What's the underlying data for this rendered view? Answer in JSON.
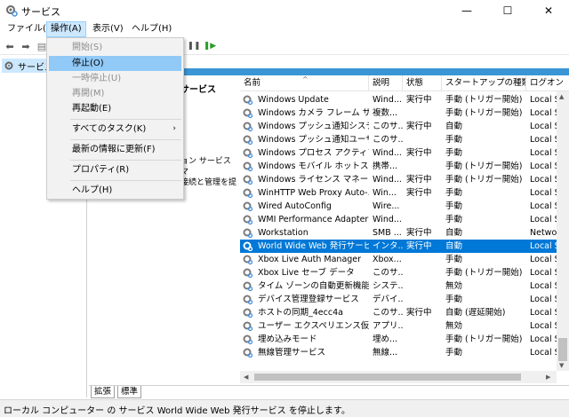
{
  "window": {
    "title": "サービス"
  },
  "menu": [
    {
      "label": "ファイル(F)"
    },
    {
      "label": "操作(A)"
    },
    {
      "label": "表示(V)"
    },
    {
      "label": "ヘルプ(H)"
    }
  ],
  "tree": {
    "label": "サービス"
  },
  "description": {
    "title": "サービス",
    "body": "ョン サービス マ\n接続と管理を提"
  },
  "columns": [
    "名前",
    "説明",
    "状態",
    "スタートアップの種類",
    "ログオン"
  ],
  "rows": [
    {
      "name": "Windows Update",
      "desc": "Wind...",
      "status": "実行中",
      "startup": "手動 (トリガー開始)",
      "logon": "Local S"
    },
    {
      "name": "Windows カメラ フレーム サーバー",
      "desc": "複数...",
      "status": "",
      "startup": "手動 (トリガー開始)",
      "logon": "Local S"
    },
    {
      "name": "Windows プッシュ通知システム...",
      "desc": "このサ...",
      "status": "実行中",
      "startup": "自動",
      "logon": "Local S"
    },
    {
      "name": "Windows プッシュ通知ユーザー...",
      "desc": "このサ...",
      "status": "",
      "startup": "手動",
      "logon": "Local S"
    },
    {
      "name": "Windows プロセス アクティブ化...",
      "desc": "Wind...",
      "status": "実行中",
      "startup": "手動",
      "logon": "Local S"
    },
    {
      "name": "Windows モバイル ホットスポッ...",
      "desc": "携帯...",
      "status": "",
      "startup": "手動 (トリガー開始)",
      "logon": "Local S"
    },
    {
      "name": "Windows ライセンス マネージャ...",
      "desc": "Wind...",
      "status": "実行中",
      "startup": "手動 (トリガー開始)",
      "logon": "Local S"
    },
    {
      "name": "WinHTTP Web Proxy Auto-...",
      "desc": "Win...",
      "status": "実行中",
      "startup": "手動",
      "logon": "Local S"
    },
    {
      "name": "Wired AutoConfig",
      "desc": "Wire...",
      "status": "",
      "startup": "手動",
      "logon": "Local S"
    },
    {
      "name": "WMI Performance Adapter",
      "desc": "Wind...",
      "status": "",
      "startup": "手動",
      "logon": "Local S"
    },
    {
      "name": "Workstation",
      "desc": "SMB ...",
      "status": "実行中",
      "startup": "自動",
      "logon": "Networ"
    },
    {
      "name": "World Wide Web 発行サービス",
      "desc": "インタ...",
      "status": "実行中",
      "startup": "自動",
      "logon": "Local S",
      "selected": true
    },
    {
      "name": "Xbox Live Auth Manager",
      "desc": "Xbox...",
      "status": "",
      "startup": "手動",
      "logon": "Local S"
    },
    {
      "name": "Xbox Live セーブ データ",
      "desc": "このサ...",
      "status": "",
      "startup": "手動 (トリガー開始)",
      "logon": "Local S"
    },
    {
      "name": "タイム ゾーンの自動更新機能",
      "desc": "システ...",
      "status": "",
      "startup": "無効",
      "logon": "Local S"
    },
    {
      "name": "デバイス管理登録サービス",
      "desc": "デバイ...",
      "status": "",
      "startup": "手動",
      "logon": "Local S"
    },
    {
      "name": "ホストの同期_4ecc4a",
      "desc": "このサ...",
      "status": "実行中",
      "startup": "自動 (遅延開始)",
      "logon": "Local S"
    },
    {
      "name": "ユーザー エクスペリエンス仮想化...",
      "desc": "アプリ...",
      "status": "",
      "startup": "無効",
      "logon": "Local S"
    },
    {
      "name": "埋め込みモード",
      "desc": "埋め...",
      "status": "",
      "startup": "手動 (トリガー開始)",
      "logon": "Local S"
    },
    {
      "name": "無線管理サービス",
      "desc": "無線...",
      "status": "",
      "startup": "手動",
      "logon": "Local S"
    }
  ],
  "dropdown": [
    {
      "label": "開始(S)",
      "disabled": true
    },
    {
      "label": "停止(O)",
      "highlight": true
    },
    {
      "label": "一時停止(U)",
      "disabled": true
    },
    {
      "label": "再開(M)",
      "disabled": true
    },
    {
      "label": "再起動(E)"
    },
    {
      "label": "すべてのタスク(K)",
      "arrow": "›"
    },
    {
      "label": "最新の情報に更新(F)"
    },
    {
      "label": "プロパティ(R)"
    },
    {
      "label": "ヘルプ(H)"
    }
  ],
  "tabs": [
    "拡張",
    "標準"
  ],
  "status": "ローカル コンピューター の サービス World Wide Web 発行サービス を停止します。",
  "colors": {
    "selection": "#0078d7",
    "header_bar": "#3a95d5",
    "menu_highlight": "#91c9f7"
  }
}
